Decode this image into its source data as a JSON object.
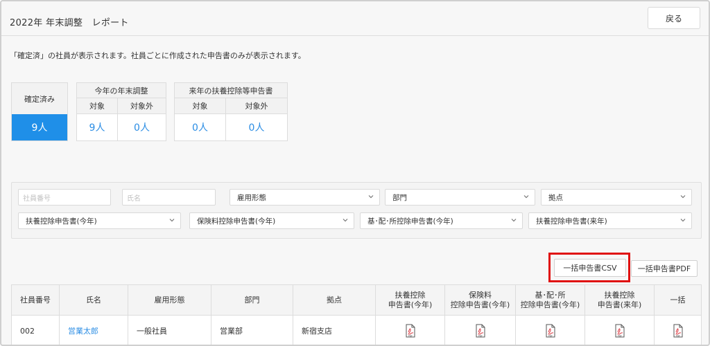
{
  "header": {
    "title": "2022年 年末調整　レポート",
    "back_label": "戻る"
  },
  "notice": "「確定済」の社員が表示されます。社員ごとに作成された申告書のみが表示されます。",
  "summary": {
    "confirmed": {
      "label": "確定済み",
      "value": "9人"
    },
    "this_year": {
      "title": "今年の年末調整",
      "target_label": "対象",
      "target_value": "9人",
      "excluded_label": "対象外",
      "excluded_value": "0人"
    },
    "next_year": {
      "title": "来年の扶養控除等申告書",
      "target_label": "対象",
      "target_value": "0人",
      "excluded_label": "対象外",
      "excluded_value": "0人"
    }
  },
  "filters": {
    "employee_no_placeholder": "社員番号",
    "name_placeholder": "氏名",
    "employment_type": "雇用形態",
    "department": "部門",
    "location": "拠点",
    "dependent_this_year": "扶養控除申告書(今年)",
    "insurance_this_year": "保険料控除申告書(今年)",
    "basic_spouse_income_this_year": "基･配･所控除申告書(今年)",
    "dependent_next_year": "扶養控除申告書(来年)"
  },
  "actions": {
    "bulk_csv": "一括申告書CSV",
    "bulk_pdf": "一括申告書PDF"
  },
  "table": {
    "headers": {
      "employee_no": "社員番号",
      "name": "氏名",
      "employment_type": "雇用形態",
      "department": "部門",
      "location": "拠点",
      "dependent_this_year_l1": "扶養控除",
      "dependent_this_year_l2": "申告書(今年)",
      "insurance_l1": "保険料",
      "insurance_l2": "控除申告書(今年)",
      "basic_l1": "基･配･所",
      "basic_l2": "控除申告書(今年)",
      "dependent_next_year_l1": "扶養控除",
      "dependent_next_year_l2": "申告書(来年)",
      "bulk": "一括"
    },
    "rows": [
      {
        "employee_no": "002",
        "name": "営業太郎",
        "employment_type": "一般社員",
        "department": "営業部",
        "location": "新宿支店",
        "pdf_icon": "pdf-file-icon"
      }
    ]
  },
  "colors": {
    "accent": "#1f8fe8",
    "link": "#2b8de4",
    "highlight": "#e01010",
    "pdf_red": "#d9363e"
  }
}
